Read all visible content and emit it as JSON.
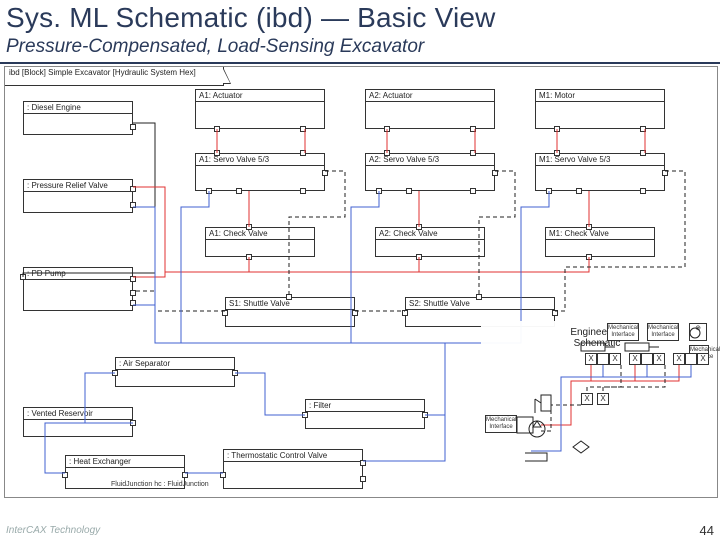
{
  "header": {
    "title": "Sys. ML Schematic (ibd) — Basic View",
    "subtitle": "Pressure-Compensated, Load-Sensing Excavator"
  },
  "footer": {
    "logo": "InterCAX Technology",
    "page": "44"
  },
  "frame": {
    "label": "ibd [Block] Simple Excavator [Hydraulic System Hex]"
  },
  "blocks": {
    "diesel": {
      "label": ": Diesel Engine"
    },
    "prv": {
      "label": ": Pressure Relief Valve"
    },
    "pdpump": {
      "label": ": PD Pump"
    },
    "airsep": {
      "label": ": Air Separator"
    },
    "vres": {
      "label": ": Vented Reservoir"
    },
    "heatx": {
      "label": ": Heat Exchanger"
    },
    "fluidjn": {
      "label": "FluidJunction hc : FluidJunction"
    },
    "thermo": {
      "label": ": Thermostatic Control Valve"
    },
    "filter": {
      "label": ": Filter"
    },
    "a1act": {
      "label": "A1: Actuator"
    },
    "a2act": {
      "label": "A2: Actuator"
    },
    "m1mot": {
      "label": "M1: Motor"
    },
    "a1sv": {
      "label": "A1: Servo Valve 5/3"
    },
    "a2sv": {
      "label": "A2: Servo Valve 5/3"
    },
    "m1sv": {
      "label": "M1: Servo Valve 5/3"
    },
    "a1cv": {
      "label": "A1: Check Valve"
    },
    "a2cv": {
      "label": "A2: Check Valve"
    },
    "m1cv": {
      "label": "M1: Check Valve"
    },
    "s1sh": {
      "label": "S1: Shuttle Valve"
    },
    "s2sh": {
      "label": "S2: Shuttle Valve"
    }
  },
  "inset": {
    "title": "Engineering Schematic",
    "boxes": {
      "mech1": {
        "label": "Mechanical Interface"
      },
      "mech2": {
        "label": "Mechanical Interface"
      },
      "mech3": {
        "label": "Mechanical Interface"
      },
      "mech4": {
        "label": "Mechanical Interface"
      },
      "x1": {
        "label": "X"
      },
      "x2": {
        "label": "X"
      },
      "x3": {
        "label": "X"
      },
      "x4": {
        "label": "X"
      },
      "x5": {
        "label": "X"
      },
      "x6": {
        "label": "X"
      },
      "x7": {
        "label": "X"
      },
      "x8": {
        "label": "X"
      }
    }
  }
}
